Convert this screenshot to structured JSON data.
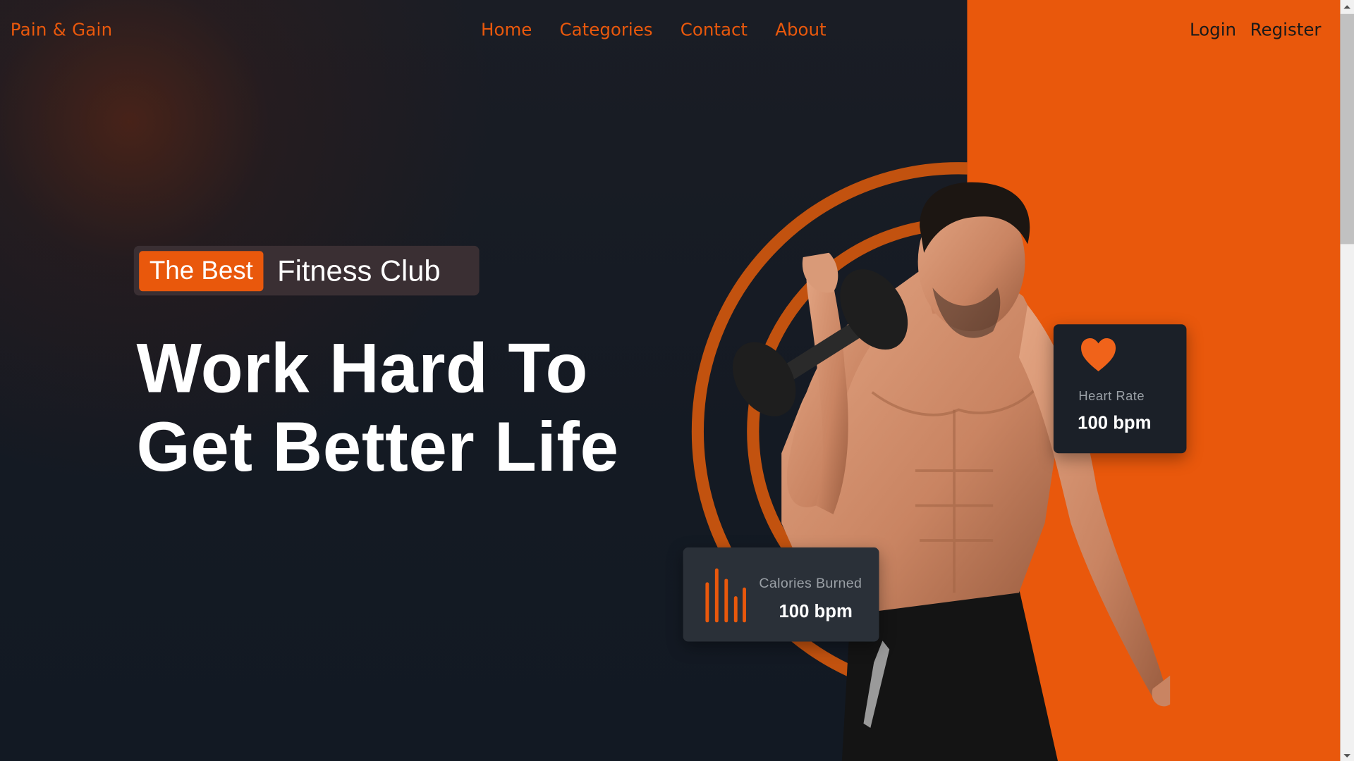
{
  "nav": {
    "brand": "Pain & Gain",
    "links": [
      {
        "label": "Home"
      },
      {
        "label": "Categories"
      },
      {
        "label": "Contact"
      },
      {
        "label": "About"
      }
    ],
    "auth": {
      "login": "Login",
      "register": "Register"
    }
  },
  "hero": {
    "badge_highlight": "The Best",
    "badge_rest": "Fitness Club",
    "title_line1": "Work Hard To",
    "title_line2": "Get Better Life"
  },
  "stats": {
    "heart": {
      "label": "Heart Rate",
      "value": "100 bpm",
      "icon": "heart-icon"
    },
    "calories": {
      "label": "Calories Burned",
      "value": "100 bpm",
      "icon": "bar-chart-icon"
    }
  },
  "colors": {
    "accent": "#e9580c",
    "background": "#141a23",
    "card": "#1b2028"
  }
}
